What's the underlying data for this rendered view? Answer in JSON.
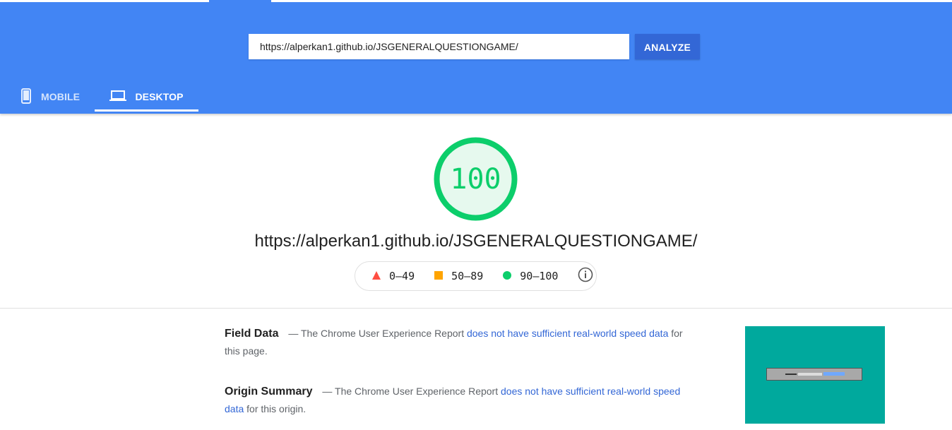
{
  "header": {
    "url_value": "https://alperkan1.github.io/JSGENERALQUESTIONGAME/",
    "analyze_label": "ANALYZE",
    "tabs": [
      {
        "label": "MOBILE",
        "icon": "phone-icon",
        "selected": false
      },
      {
        "label": "DESKTOP",
        "icon": "laptop-icon",
        "selected": true
      }
    ],
    "color": "#4285f4"
  },
  "score": {
    "value": "100",
    "color": "#0cce6b",
    "page_url": "https://alperkan1.github.io/JSGENERALQUESTIONGAME/"
  },
  "legend": {
    "items": [
      {
        "label": "0–49",
        "icon": "red-triangle-icon",
        "color": "#ff4e42"
      },
      {
        "label": "50–89",
        "icon": "orange-square-icon",
        "color": "#ffa400"
      },
      {
        "label": "90–100",
        "icon": "green-circle-icon",
        "color": "#0cce6b"
      }
    ],
    "info_icon": "info-icon"
  },
  "field_data": {
    "heading": "Field Data",
    "dash_text": "— The Chrome User Experience Report",
    "link_text": "does not have sufficient real-world speed data",
    "tail_text": "for this page."
  },
  "origin_summary": {
    "heading": "Origin Summary",
    "dash_text": "— The Chrome User Experience Report",
    "link_text": "does not have sufficient real-world speed data",
    "tail_text": "for this origin."
  },
  "thumbnail": {
    "background": "#00a99d"
  }
}
